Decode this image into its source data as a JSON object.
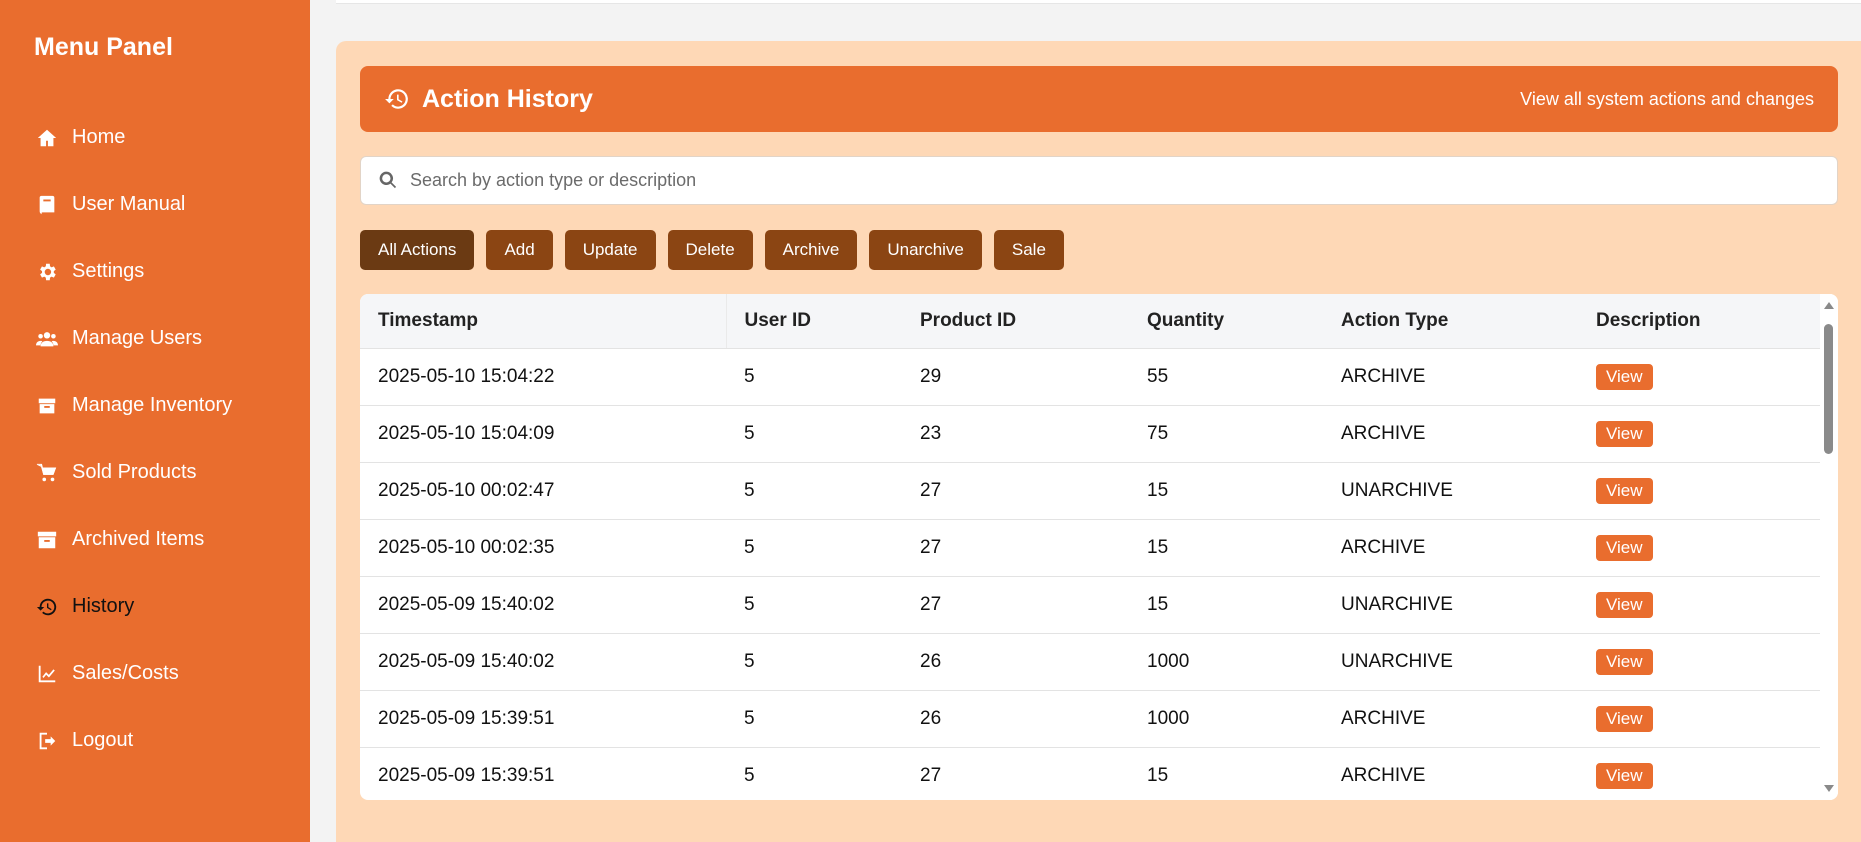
{
  "sidebar": {
    "title": "Menu Panel",
    "items": [
      {
        "label": "Home",
        "icon": "home-icon"
      },
      {
        "label": "User Manual",
        "icon": "book-icon"
      },
      {
        "label": "Settings",
        "icon": "gear-icon"
      },
      {
        "label": "Manage Users",
        "icon": "users-icon"
      },
      {
        "label": "Manage Inventory",
        "icon": "box-icon"
      },
      {
        "label": "Sold Products",
        "icon": "cart-icon"
      },
      {
        "label": "Archived Items",
        "icon": "archive-icon"
      },
      {
        "label": "History",
        "icon": "history-icon",
        "active": true
      },
      {
        "label": "Sales/Costs",
        "icon": "chart-line-icon"
      },
      {
        "label": "Logout",
        "icon": "logout-icon"
      }
    ]
  },
  "header": {
    "title": "Action History",
    "subtitle": "View all system actions and changes"
  },
  "search": {
    "placeholder": "Search by action type or description",
    "value": ""
  },
  "filters": [
    {
      "label": "All Actions",
      "active": true
    },
    {
      "label": "Add"
    },
    {
      "label": "Update"
    },
    {
      "label": "Delete"
    },
    {
      "label": "Archive"
    },
    {
      "label": "Unarchive"
    },
    {
      "label": "Sale"
    }
  ],
  "table": {
    "columns": [
      "Timestamp",
      "User ID",
      "Product ID",
      "Quantity",
      "Action Type",
      "Description"
    ],
    "view_label": "View",
    "rows": [
      {
        "timestamp": "2025-05-10 15:04:22",
        "user_id": "5",
        "product_id": "29",
        "quantity": "55",
        "action_type": "ARCHIVE"
      },
      {
        "timestamp": "2025-05-10 15:04:09",
        "user_id": "5",
        "product_id": "23",
        "quantity": "75",
        "action_type": "ARCHIVE"
      },
      {
        "timestamp": "2025-05-10 00:02:47",
        "user_id": "5",
        "product_id": "27",
        "quantity": "15",
        "action_type": "UNARCHIVE"
      },
      {
        "timestamp": "2025-05-10 00:02:35",
        "user_id": "5",
        "product_id": "27",
        "quantity": "15",
        "action_type": "ARCHIVE"
      },
      {
        "timestamp": "2025-05-09 15:40:02",
        "user_id": "5",
        "product_id": "27",
        "quantity": "15",
        "action_type": "UNARCHIVE"
      },
      {
        "timestamp": "2025-05-09 15:40:02",
        "user_id": "5",
        "product_id": "26",
        "quantity": "1000",
        "action_type": "UNARCHIVE"
      },
      {
        "timestamp": "2025-05-09 15:39:51",
        "user_id": "5",
        "product_id": "26",
        "quantity": "1000",
        "action_type": "ARCHIVE"
      },
      {
        "timestamp": "2025-05-09 15:39:51",
        "user_id": "5",
        "product_id": "27",
        "quantity": "15",
        "action_type": "ARCHIVE"
      }
    ]
  },
  "colors": {
    "accent": "#e96d2e",
    "panel_bg": "#fed8b6",
    "filter_btn": "#8b4513",
    "filter_btn_active": "#6b3a13"
  }
}
